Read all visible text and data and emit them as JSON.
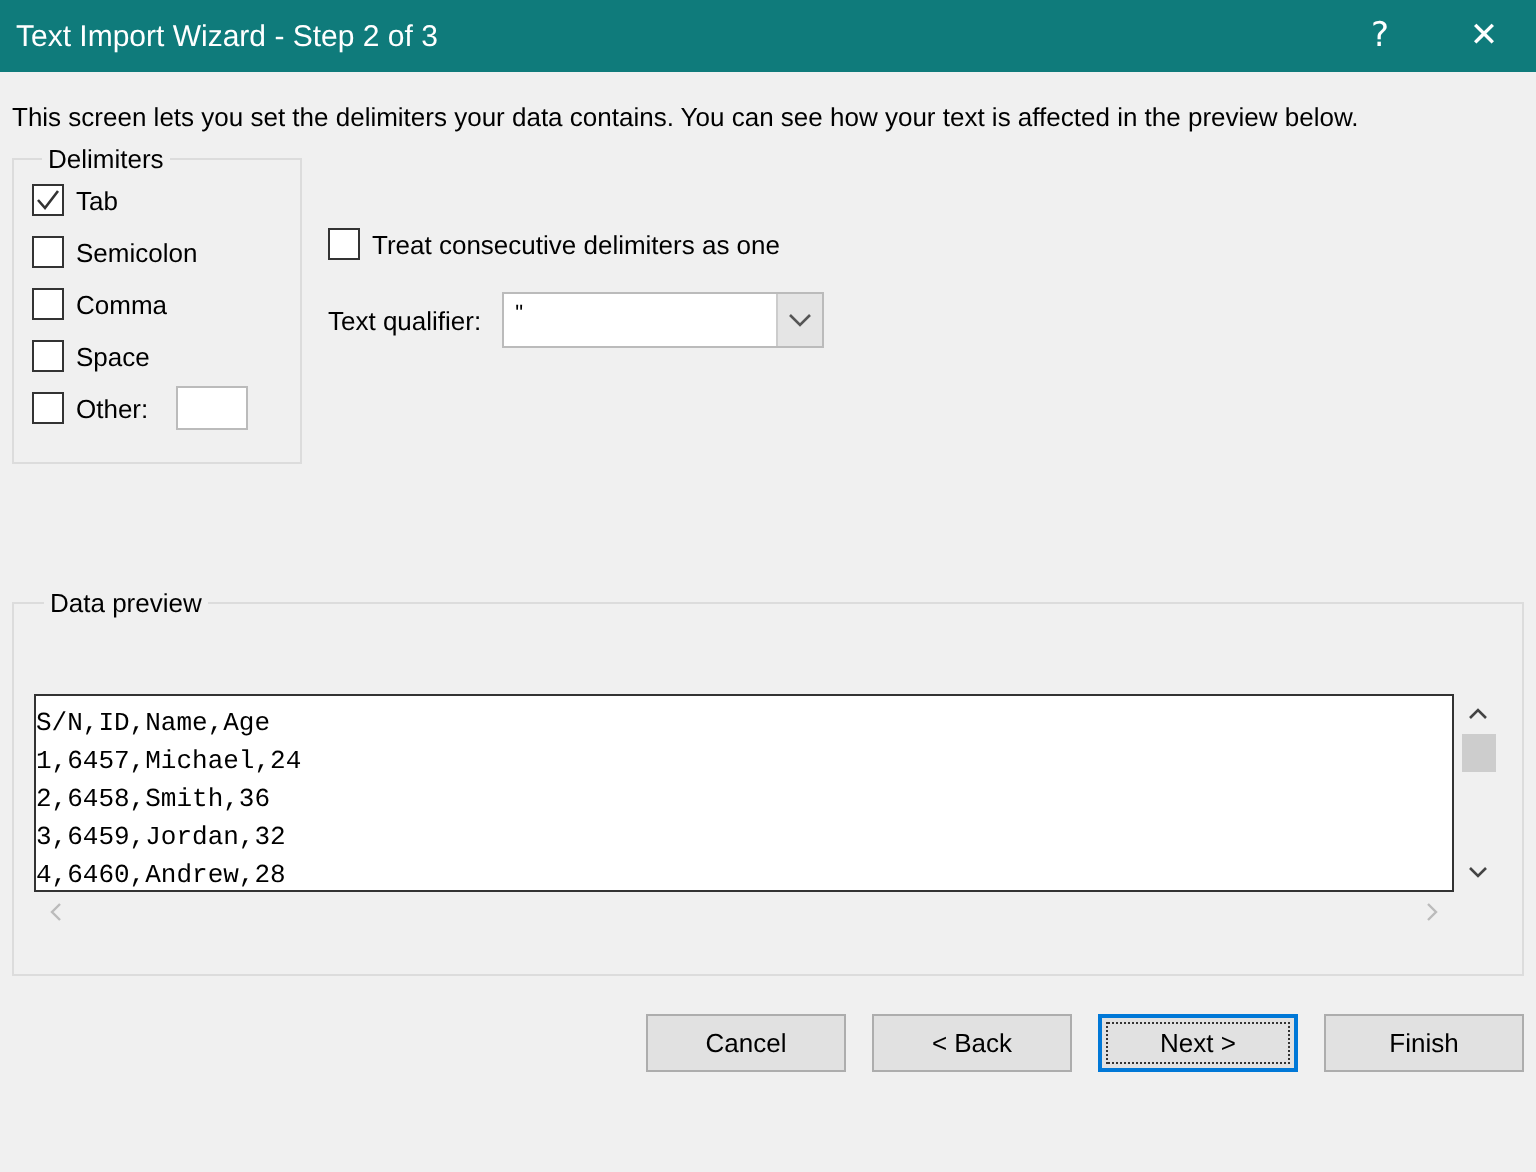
{
  "window": {
    "title": "Text Import Wizard - Step 2 of 3",
    "help": "?",
    "close": "✕"
  },
  "intro": "This screen lets you set the delimiters your data contains.  You can see how your text is affected in the preview below.",
  "delimiters": {
    "title": "Delimiters",
    "items": [
      {
        "label": "Tab",
        "checked": true
      },
      {
        "label": "Semicolon",
        "checked": false
      },
      {
        "label": "Comma",
        "checked": false
      },
      {
        "label": "Space",
        "checked": false
      },
      {
        "label": "Other:",
        "checked": false,
        "has_field": true
      }
    ]
  },
  "consecutive": {
    "label": "Treat consecutive delimiters as one",
    "checked": false
  },
  "text_qualifier": {
    "label": "Text qualifier:",
    "value": "\""
  },
  "data_preview": {
    "title": "Data preview",
    "lines": [
      "S/N,ID,Name,Age",
      "1,6457,Michael,24",
      "2,6458,Smith,36",
      "3,6459,Jordan,32",
      "4,6460,Andrew,28"
    ]
  },
  "buttons": [
    {
      "label": "Cancel",
      "default": false
    },
    {
      "label": "< Back",
      "default": false
    },
    {
      "label": "Next >",
      "default": true
    },
    {
      "label": "Finish",
      "default": false
    }
  ]
}
